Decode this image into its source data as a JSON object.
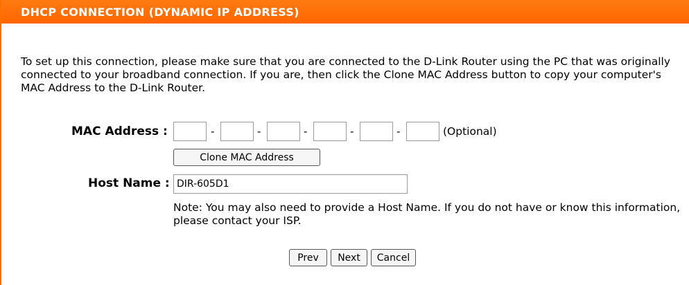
{
  "header": {
    "title": "DHCP CONNECTION (DYNAMIC IP ADDRESS)"
  },
  "description": "To set up this connection, please make sure that you are connected to the D-Link Router using the PC that was originally connected to your broadband connection. If you are, then click the Clone MAC Address button to copy your computer's MAC Address to the D-Link Router.",
  "mac": {
    "label": "MAC Address :",
    "octets": [
      "",
      "",
      "",
      "",
      "",
      ""
    ],
    "separator": "-",
    "optional_label": "(Optional)",
    "clone_button": "Clone MAC Address"
  },
  "host": {
    "label": "Host Name :",
    "value": "DIR-605D1"
  },
  "note": "Note: You may also need to provide a Host Name. If you do not have or know this information, please contact your ISP.",
  "buttons": {
    "prev": "Prev",
    "next": "Next",
    "cancel": "Cancel"
  },
  "colors": {
    "accent": "#ff6600",
    "header_text": "#ffffff"
  }
}
